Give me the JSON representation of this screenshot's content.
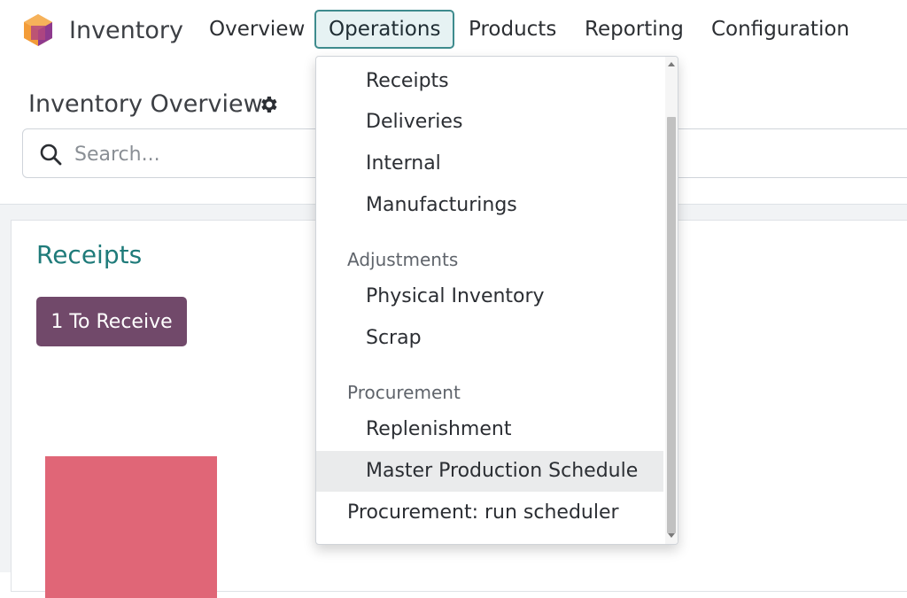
{
  "app": {
    "name": "Inventory"
  },
  "navbar": {
    "menu": [
      {
        "label": "Overview"
      },
      {
        "label": "Operations"
      },
      {
        "label": "Products"
      },
      {
        "label": "Reporting"
      },
      {
        "label": "Configuration"
      }
    ]
  },
  "control_panel": {
    "title": "Inventory Overview",
    "search_placeholder": "Search..."
  },
  "card": {
    "title": "Receipts",
    "button_label": "1 To Receive"
  },
  "dropdown": {
    "transfers": [
      "Receipts",
      "Deliveries",
      "Internal",
      "Manufacturings"
    ],
    "adjustments_header": "Adjustments",
    "adjustments": [
      "Physical Inventory",
      "Scrap"
    ],
    "procurement_header": "Procurement",
    "procurement": [
      "Replenishment",
      "Master Production Schedule"
    ],
    "run_scheduler": "Procurement: run scheduler"
  },
  "colors": {
    "accent": "#3e8b8d",
    "card_title": "#1f7b7a",
    "button": "#71496a",
    "graph_bar": "#e06677"
  }
}
